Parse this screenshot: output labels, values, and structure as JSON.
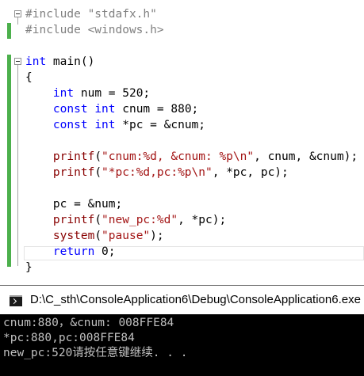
{
  "editor": {
    "lines": [
      {
        "parts": [
          {
            "text": "#include \"stdafx.h\"",
            "cls": "pp"
          }
        ]
      },
      {
        "parts": [
          {
            "text": "#include <windows.h>",
            "cls": "pp"
          }
        ]
      },
      {
        "parts": []
      },
      {
        "parts": [
          {
            "text": "int",
            "cls": "kw"
          },
          {
            "text": " main()",
            "cls": ""
          }
        ]
      },
      {
        "parts": [
          {
            "text": "{",
            "cls": ""
          }
        ]
      },
      {
        "parts": [
          {
            "text": "    ",
            "cls": ""
          },
          {
            "text": "int",
            "cls": "kw"
          },
          {
            "text": " num = 520;",
            "cls": ""
          }
        ]
      },
      {
        "parts": [
          {
            "text": "    ",
            "cls": ""
          },
          {
            "text": "const",
            "cls": "kw"
          },
          {
            "text": " ",
            "cls": ""
          },
          {
            "text": "int",
            "cls": "kw"
          },
          {
            "text": " cnum = 880;",
            "cls": ""
          }
        ]
      },
      {
        "parts": [
          {
            "text": "    ",
            "cls": ""
          },
          {
            "text": "const",
            "cls": "kw"
          },
          {
            "text": " ",
            "cls": ""
          },
          {
            "text": "int",
            "cls": "kw"
          },
          {
            "text": " *pc = &cnum;",
            "cls": ""
          }
        ]
      },
      {
        "parts": []
      },
      {
        "parts": [
          {
            "text": "    ",
            "cls": ""
          },
          {
            "text": "printf",
            "cls": "fn"
          },
          {
            "text": "(",
            "cls": ""
          },
          {
            "text": "\"cnum:%d, &cnum: %p\\n\"",
            "cls": "str"
          },
          {
            "text": ", cnum, &cnum);",
            "cls": ""
          }
        ]
      },
      {
        "parts": [
          {
            "text": "    ",
            "cls": ""
          },
          {
            "text": "printf",
            "cls": "fn"
          },
          {
            "text": "(",
            "cls": ""
          },
          {
            "text": "\"*pc:%d,pc:%p\\n\"",
            "cls": "str"
          },
          {
            "text": ", *pc, pc);",
            "cls": ""
          }
        ]
      },
      {
        "parts": []
      },
      {
        "parts": [
          {
            "text": "    pc = &num;",
            "cls": ""
          }
        ]
      },
      {
        "parts": [
          {
            "text": "    ",
            "cls": ""
          },
          {
            "text": "printf",
            "cls": "fn"
          },
          {
            "text": "(",
            "cls": ""
          },
          {
            "text": "\"new_pc:%d\"",
            "cls": "str"
          },
          {
            "text": ", *pc);",
            "cls": ""
          }
        ]
      },
      {
        "parts": [
          {
            "text": "    ",
            "cls": ""
          },
          {
            "text": "system",
            "cls": "fn"
          },
          {
            "text": "(",
            "cls": ""
          },
          {
            "text": "\"pause\"",
            "cls": "str"
          },
          {
            "text": ");",
            "cls": ""
          }
        ]
      },
      {
        "parts": [
          {
            "text": "    ",
            "cls": ""
          },
          {
            "text": "return",
            "cls": "kw"
          },
          {
            "text": " 0;",
            "cls": ""
          }
        ]
      },
      {
        "parts": [
          {
            "text": "}",
            "cls": ""
          }
        ]
      }
    ]
  },
  "console": {
    "title": "D:\\C_sth\\ConsoleApplication6\\Debug\\ConsoleApplication6.exe",
    "output": [
      "cnum:880，&cnum: 008FFE84",
      "*pc:880,pc:008FFE84",
      "new_pc:520请按任意键继续. . ."
    ]
  }
}
